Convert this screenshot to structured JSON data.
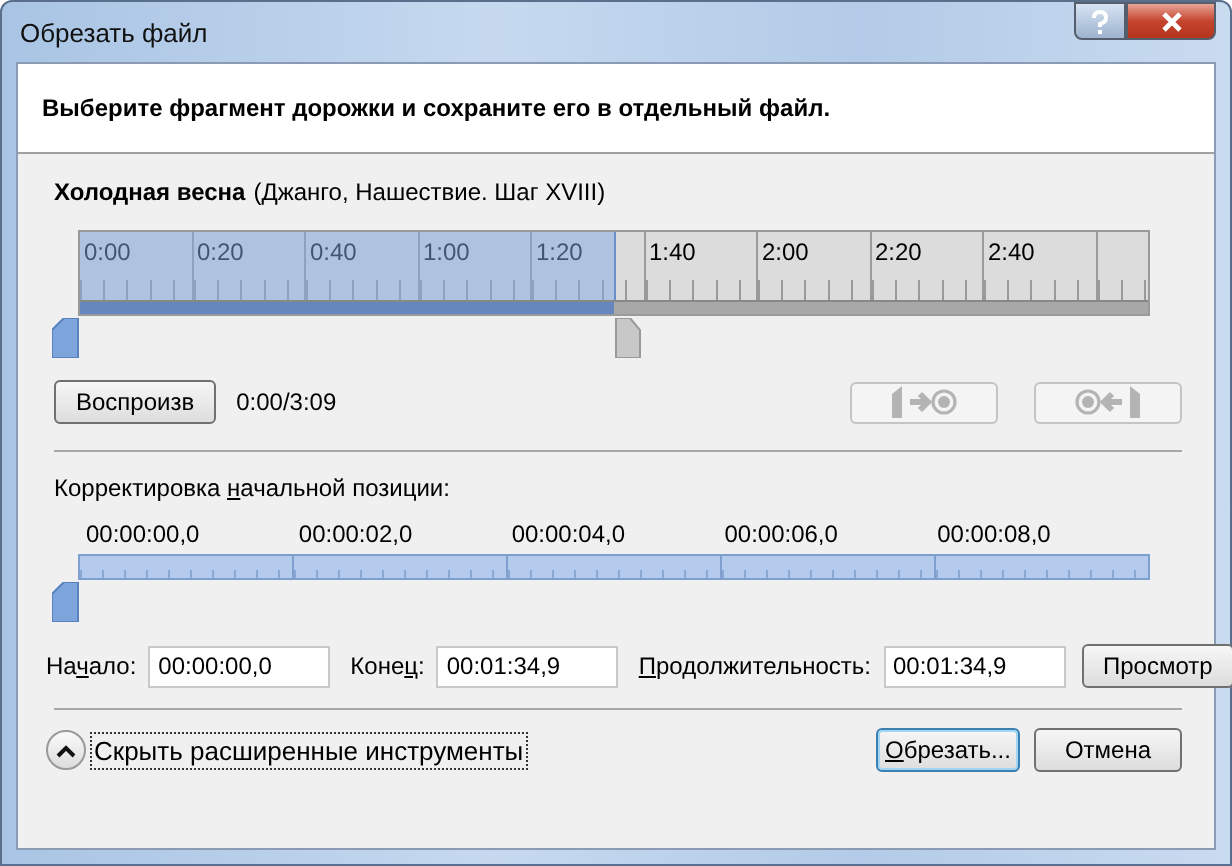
{
  "window": {
    "title": "Обрезать файл"
  },
  "header": {
    "instruction": "Выберите фрагмент дорожки и сохраните его в отдельный файл."
  },
  "track": {
    "title": "Холодная весна",
    "details": "(Джанго, Нашествие. Шаг XVIII)"
  },
  "timeline": {
    "labels": [
      "0:00",
      "0:20",
      "0:40",
      "1:00",
      "1:20",
      "1:40",
      "2:00",
      "2:20",
      "2:40"
    ],
    "level": 0.5
  },
  "playback": {
    "play_button": "Воспроизв",
    "position": "0:00/3:09"
  },
  "nav_buttons": [
    {
      "kind": "to-start",
      "disabled": true
    },
    {
      "kind": "to-end",
      "disabled": true
    }
  ],
  "fine_tune": {
    "label": {
      "before": "Корректировка ",
      "key": "н",
      "after": "ачальной позиции:"
    },
    "labels": [
      "00:00:00,0",
      "00:00:02,0",
      "00:00:04,0",
      "00:00:06,0",
      "00:00:08,0"
    ],
    "level": 0
  },
  "fields": [
    {
      "label": {
        "before": "На",
        "key": "ч",
        "after": "ало:"
      },
      "value": "00:00:00,0"
    },
    {
      "label": {
        "before": "Коне",
        "key": "ц",
        "after": ":"
      },
      "value": "00:01:34,9"
    },
    {
      "label": {
        "key": "П",
        "after": "родолжительность:"
      },
      "value": "00:01:34,9"
    }
  ],
  "preview_button": "Просмотр",
  "toggle": {
    "label": "Скрыть расширенные инструменты",
    "expanded": true
  },
  "buttons": [
    {
      "label": {
        "key": "О",
        "after": "брезать..."
      },
      "default": true
    },
    {
      "label": {
        "before": "Отмена"
      },
      "default": false
    }
  ]
}
